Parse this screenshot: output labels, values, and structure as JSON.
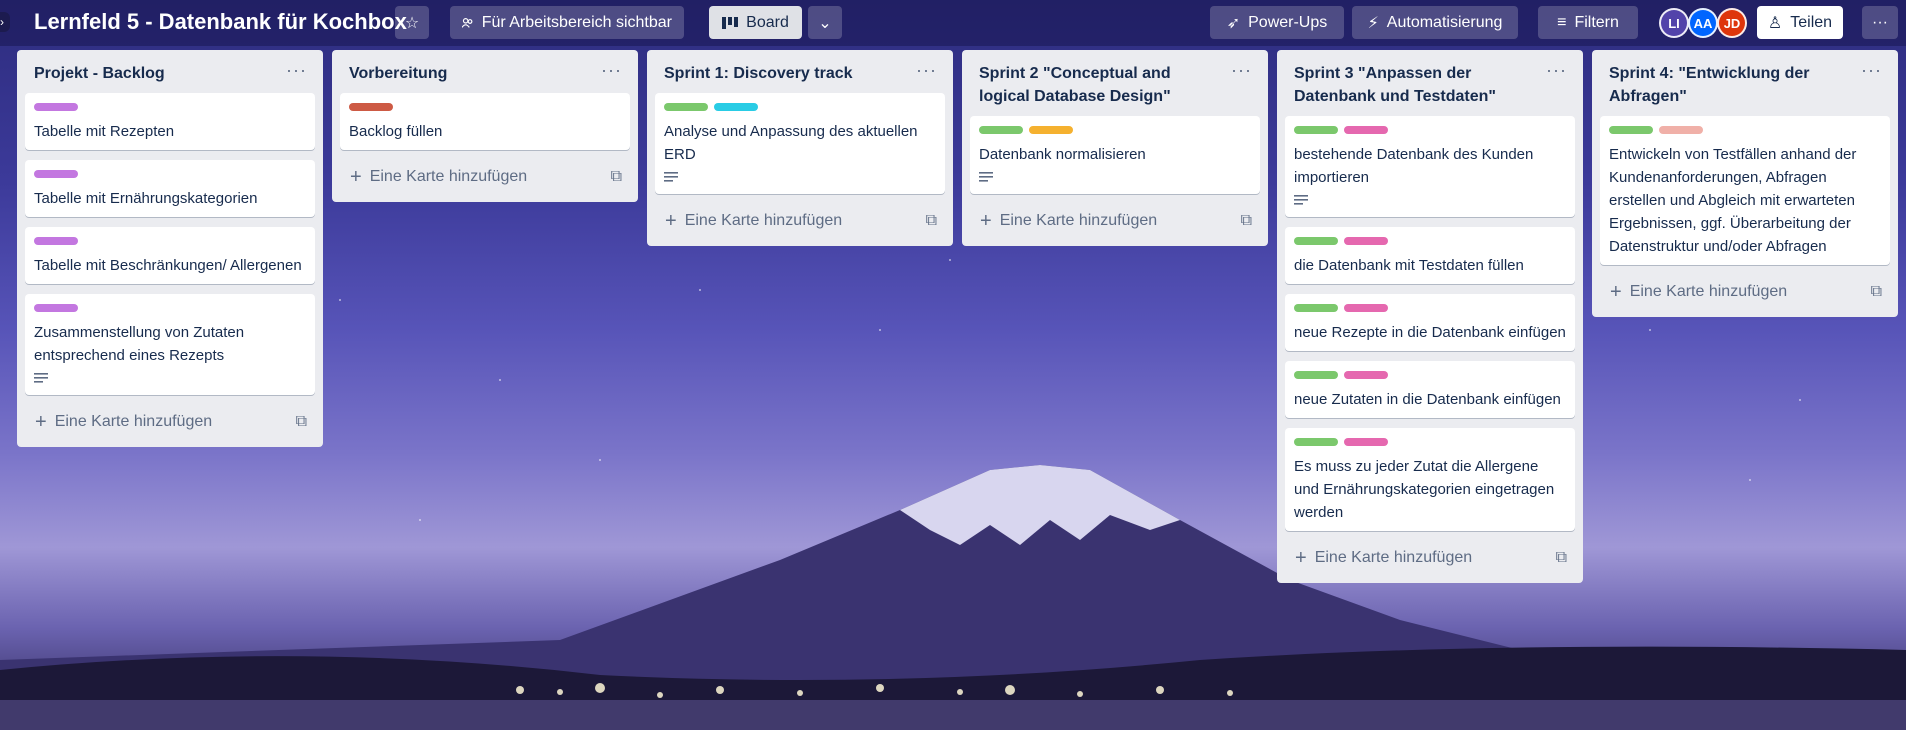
{
  "board": {
    "title": "Lernfeld 5 - Datenbank für Kochbox"
  },
  "header": {
    "visibility_label": "Für Arbeitsbereich sichtbar",
    "view_label": "Board",
    "powerups_label": "Power-Ups",
    "automation_label": "Automatisierung",
    "filter_label": "Filtern",
    "share_label": "Teilen",
    "members": [
      "LI",
      "AA",
      "JD"
    ]
  },
  "colors": {
    "purple": "#c377e0",
    "red": "#cd5a44",
    "green": "#7bc86c",
    "sky": "#29cce5",
    "orange": "#f5b12f",
    "pink": "#e568af",
    "salmon": "#f0b0a8"
  },
  "add_card_label": "Eine Karte hinzufügen",
  "lists": [
    {
      "title": "Projekt - Backlog",
      "cards": [
        {
          "text": "Tabelle mit Rezepten",
          "labels": [
            "purple"
          ]
        },
        {
          "text": "Tabelle mit Ernährungskategorien",
          "labels": [
            "purple"
          ]
        },
        {
          "text": "Tabelle mit Beschränkungen/ Allergenen",
          "labels": [
            "purple"
          ]
        },
        {
          "text": "Zusammenstellung von Zutaten entsprechend eines Rezepts",
          "labels": [
            "purple"
          ],
          "has_description": true
        }
      ]
    },
    {
      "title": "Vorbereitung",
      "cards": [
        {
          "text": "Backlog füllen",
          "labels": [
            "red"
          ]
        }
      ]
    },
    {
      "title": "Sprint 1: Discovery track",
      "cards": [
        {
          "text": "Analyse und Anpassung des aktuellen ERD",
          "labels": [
            "green",
            "sky"
          ],
          "has_description": true
        }
      ]
    },
    {
      "title": "Sprint 2 \"Conceptual and logical Database Design\"",
      "cards": [
        {
          "text": "Datenbank normalisieren",
          "labels": [
            "green",
            "orange"
          ],
          "has_description": true
        }
      ]
    },
    {
      "title": "Sprint 3 \"Anpassen der Datenbank und Testdaten\"",
      "cards": [
        {
          "text": "bestehende Datenbank des Kunden importieren",
          "labels": [
            "green",
            "pink"
          ],
          "has_description": true
        },
        {
          "text": "die Datenbank mit Testdaten füllen",
          "labels": [
            "green",
            "pink"
          ]
        },
        {
          "text": "neue Rezepte in die Datenbank einfügen",
          "labels": [
            "green",
            "pink"
          ]
        },
        {
          "text": "neue Zutaten in die Datenbank einfügen",
          "labels": [
            "green",
            "pink"
          ]
        },
        {
          "text": "Es muss zu jeder Zutat die Allergene und Ernährungskategorien eingetragen werden",
          "labels": [
            "green",
            "pink"
          ]
        }
      ]
    },
    {
      "title": "Sprint 4: \"Entwicklung der Abfragen\"",
      "cards": [
        {
          "text": "Entwickeln von Testfällen anhand der Kundenanforderungen, Abfragen erstellen und Abgleich mit erwarteten Ergebnissen, ggf. Überarbeitung der Datenstruktur und/oder Abfragen",
          "labels": [
            "green",
            "salmon"
          ]
        }
      ]
    }
  ]
}
